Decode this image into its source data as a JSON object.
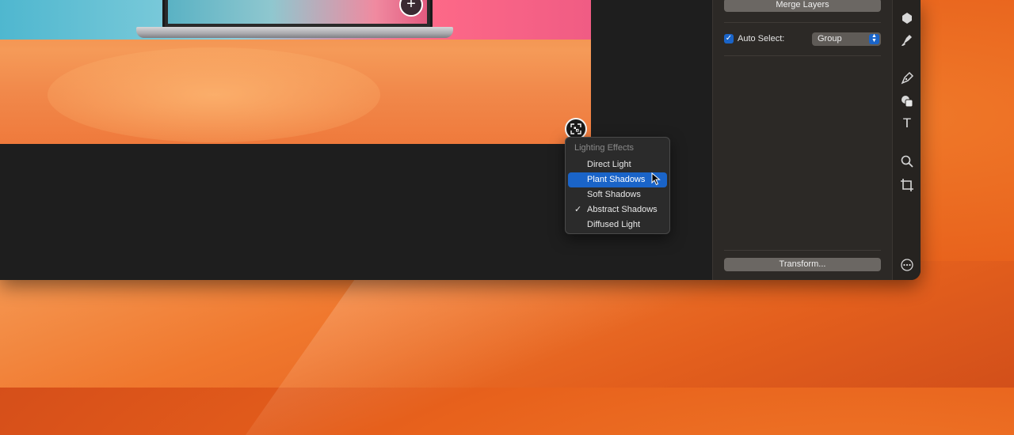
{
  "canvas": {
    "plus_symbol": "+"
  },
  "lighting_menu": {
    "header": "Lighting Effects",
    "items": [
      {
        "label": "Direct Light",
        "checked": false,
        "highlighted": false
      },
      {
        "label": "Plant Shadows",
        "checked": false,
        "highlighted": true
      },
      {
        "label": "Soft Shadows",
        "checked": false,
        "highlighted": false
      },
      {
        "label": "Abstract Shadows",
        "checked": true,
        "highlighted": false
      },
      {
        "label": "Diffused Light",
        "checked": false,
        "highlighted": false
      }
    ],
    "check_glyph": "✓"
  },
  "right_panel": {
    "merge_layers_label": "Merge Layers",
    "auto_select_label": "Auto Select:",
    "auto_select_checked": true,
    "auto_select_value": "Group",
    "transform_label": "Transform..."
  },
  "toolbar": {
    "tools": [
      "shape-icon",
      "brush-icon",
      "pen-icon",
      "shapes-icon",
      "text-icon",
      "zoom-icon",
      "crop-icon",
      "more-icon"
    ],
    "text_tool_glyph": "T"
  },
  "colors": {
    "accent": "#1a64c8",
    "panel_bg": "#2c2926",
    "window_bg": "#1e1e1e"
  }
}
